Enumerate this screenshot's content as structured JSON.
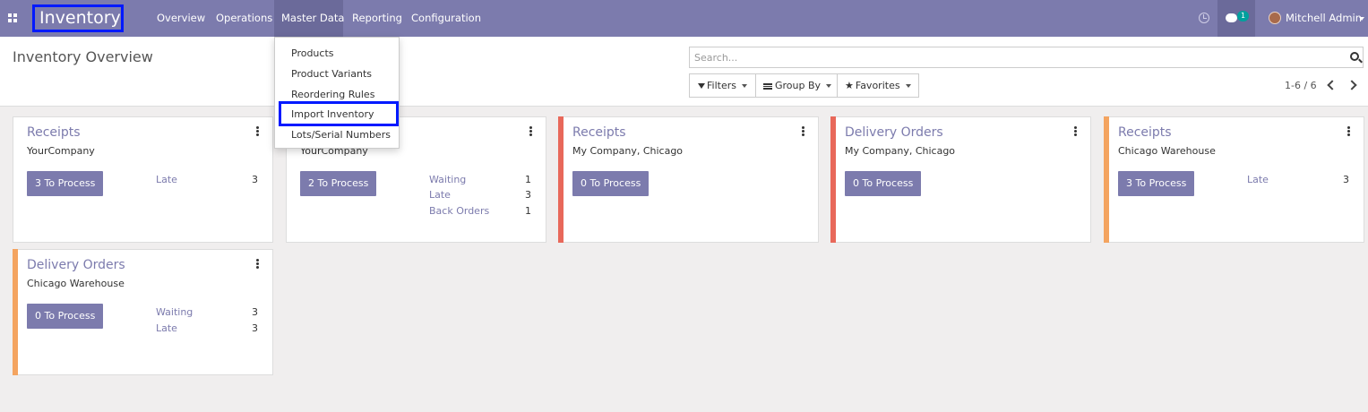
{
  "navbar": {
    "brand": "Inventory",
    "menu": [
      "Overview",
      "Operations",
      "Master Data",
      "Reporting",
      "Configuration"
    ],
    "active_menu": "Master Data",
    "chat_count": "1",
    "user_name": "Mitchell Admin"
  },
  "control_panel": {
    "title": "Inventory Overview",
    "search_placeholder": "Search...",
    "filters_label": "Filters",
    "group_by_label": "Group By",
    "favorites_label": "Favorites",
    "pager": "1-6 / 6"
  },
  "dropdown": {
    "items": [
      "Products",
      "Product Variants",
      "Reordering Rules",
      "Import Inventory",
      "Lots/Serial Numbers"
    ],
    "highlighted": "Import Inventory"
  },
  "cards": [
    {
      "title": "Receipts",
      "subtitle": "YourCompany",
      "button": "3 To Process",
      "accent": "",
      "stats": [
        {
          "label": "Late",
          "value": "3"
        }
      ]
    },
    {
      "title": "",
      "subtitle": "YourCompany",
      "button": "2 To Process",
      "accent": "",
      "stats": [
        {
          "label": "Waiting",
          "value": "1"
        },
        {
          "label": "Late",
          "value": "3"
        },
        {
          "label": "Back Orders",
          "value": "1"
        }
      ]
    },
    {
      "title": "Receipts",
      "subtitle": "My Company, Chicago",
      "button": "0 To Process",
      "accent": "#e8685a",
      "stats": []
    },
    {
      "title": "Delivery Orders",
      "subtitle": "My Company, Chicago",
      "button": "0 To Process",
      "accent": "#e8685a",
      "stats": []
    },
    {
      "title": "Receipts",
      "subtitle": "Chicago Warehouse",
      "button": "3 To Process",
      "accent": "#f4a460",
      "stats": [
        {
          "label": "Late",
          "value": "3"
        }
      ]
    },
    {
      "title": "Delivery Orders",
      "subtitle": "Chicago Warehouse",
      "button": "0 To Process",
      "accent": "#f4a460",
      "stats": [
        {
          "label": "Waiting",
          "value": "3"
        },
        {
          "label": "Late",
          "value": "3"
        }
      ]
    }
  ],
  "colors": {
    "primary": "#7c7bad",
    "danger_accent": "#e8685a",
    "warning_accent": "#f4a460",
    "highlight_box": "#0019ff"
  }
}
